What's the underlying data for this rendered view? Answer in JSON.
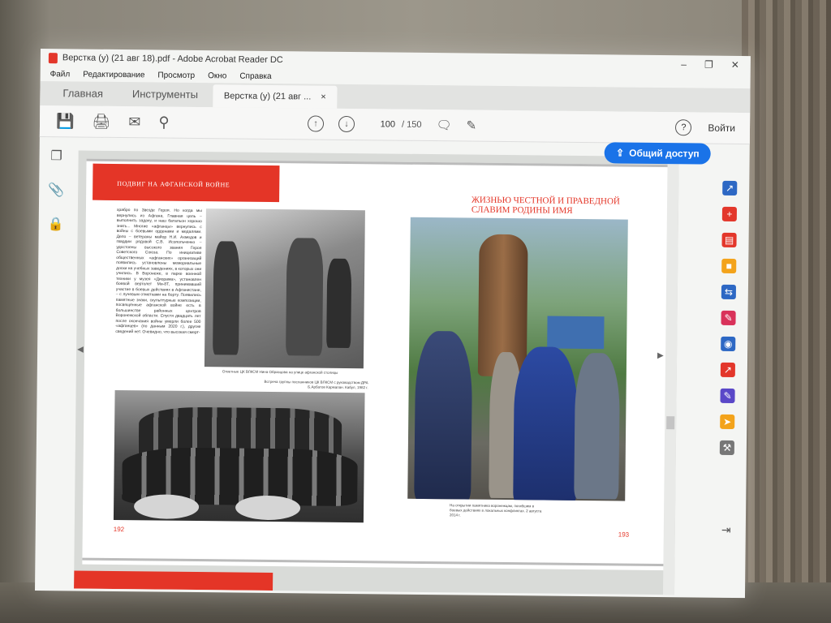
{
  "window": {
    "title": "Верстка (у) (21 авг 18).pdf - Adobe Acrobat Reader DC",
    "controls": [
      "–",
      "❐",
      "✕"
    ]
  },
  "menu": [
    "Файл",
    "Редактирование",
    "Просмотр",
    "Окно",
    "Справка"
  ],
  "tabs": {
    "home": "Главная",
    "tools": "Инструменты",
    "document": "Верстка (у) (21 авг ...",
    "close": "×"
  },
  "toolbar": {
    "page_current": "100",
    "page_total": "/ 150",
    "help": "?",
    "signin": "Войти",
    "share": "Общий доступ"
  },
  "document": {
    "left_page": {
      "chapter_heading": "ПОДВИГ НА АФГАНСКОЙ ВОЙНЕ",
      "body_text": "храбро по Звезде Героя. Но когда мы вернулись из Афгана, Главная цель – выполнить задачу, и наш батальон хорошо знать... Многие «афганцы» вернулись с войны с боевыми орденами и медалями. Дело – ветераны майор Н.И. Ахмедов и гвардии рядовой С.В. Исопольченко – удостоены высокого звания Героя Советского Союза. По инициативе общественных «афганских» организаций появились установлены мемориальные доски на учебных заведениях, в которых они учились. В Воронеже, в парке военной техники у музея «Диорама», установлен боевой вертолет Ми-8Т, принимавший участие в боевых действиях в Афганистане, – с лучевым отметками на борту. Появились памятные знаки, скульптурные композиции, посвящённые афганской войне есть в большинстве районных центров Воронежской области. Спустя двадцать лет после окончания войны умерли более 500 «афганцев» (по данным 2020 г.), другие сведений нет. Очевидно, что высокая смерт-",
      "photo1_caption": "Ответные ЦК ВЛКСМ Нина Образцова на улице афганской столицы",
      "photo2_caption": "Встреча группы посланников ЦК ВЛКСМ с руководством ДРА Б.Арбатов Кармапан. Кабул, 1982 г.",
      "page_number": "192"
    },
    "right_page": {
      "headline": "ЖИЗНЬЮ ЧЕСТНОЙ И ПРАВЕДНОЙ СЛАВИМ РОДИНЫ ИМЯ",
      "photo_caption": "На открытии памятника воронежцам, погибшим в боевых действиях в локальных конфликтах. 2 августа 2014 г.",
      "page_number": "193"
    }
  },
  "colors": {
    "accent_red": "#e43527",
    "share_blue": "#1a73e8"
  },
  "icons": {
    "left_rail": [
      "pages-icon",
      "attachment-icon",
      "security-lock-icon"
    ],
    "right_rail": [
      "export-pdf-icon",
      "create-pdf-icon",
      "edit-pdf-icon",
      "comment-icon",
      "combine-files-icon",
      "fill-sign-icon",
      "protect-icon",
      "export-icon",
      "sign-icon",
      "send-icon",
      "more-tools-icon"
    ]
  }
}
